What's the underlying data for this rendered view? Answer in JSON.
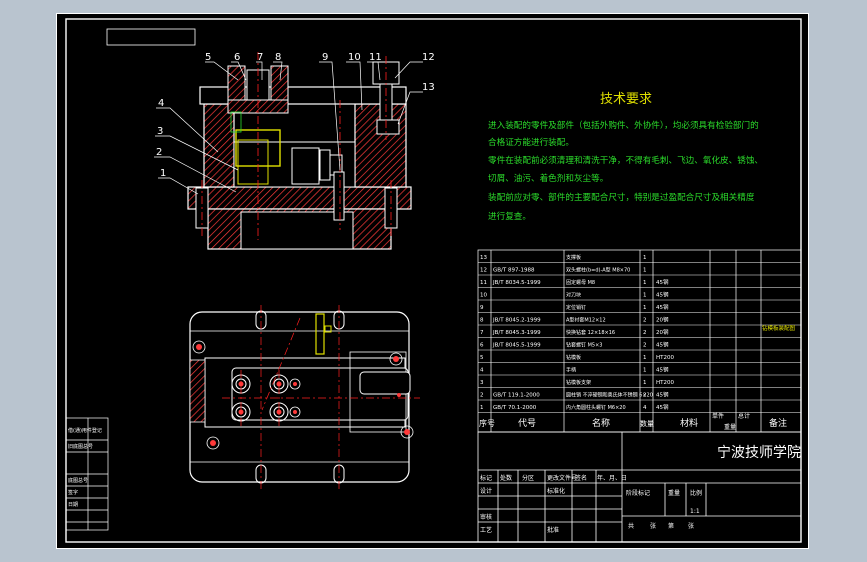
{
  "tech_title": "技术要求",
  "tech_requirements": [
    "进入装配的零件及部件（包括外购件、外协件），均必须具有检验部门的",
    "合格证方能进行装配。",
    "零件在装配前必须清理和清洗干净，不得有毛刺、飞边、氧化皮、锈蚀、",
    "切屑、油污、着色剂和灰尘等。",
    "装配前应对零、部件的主要配合尺寸，特别是过盈配合尺寸及相关精度",
    "进行复查。"
  ],
  "balloons": [
    "1",
    "2",
    "3",
    "4",
    "5",
    "6",
    "7",
    "8",
    "9",
    "10",
    "11",
    "12",
    "13"
  ],
  "bom_rows": [
    {
      "no": "13",
      "code": "",
      "name": "支撑板",
      "qty": "1",
      "material": ""
    },
    {
      "no": "12",
      "code": "GB/T 897-1988",
      "name": "双头螺柱(b=d)-A型 M8×70",
      "qty": "1",
      "material": ""
    },
    {
      "no": "11",
      "code": "JB/T 8034.5-1999",
      "name": "固定螺母 M8",
      "qty": "1",
      "material": "45钢"
    },
    {
      "no": "10",
      "code": "",
      "name": "对刀块",
      "qty": "1",
      "material": "45钢"
    },
    {
      "no": "9",
      "code": "",
      "name": "定位销钉",
      "qty": "1",
      "material": "45钢"
    },
    {
      "no": "8",
      "code": "JB/T 8045.2-1999",
      "name": "A型衬套M12×12",
      "qty": "2",
      "material": "20钢"
    },
    {
      "no": "7",
      "code": "JB/T 8045.3-1999",
      "name": "快换钻套 12×18×16",
      "qty": "2",
      "material": "20钢"
    },
    {
      "no": "6",
      "code": "JB/T 8045.5-1999",
      "name": "钻套螺钉 M5×3",
      "qty": "2",
      "material": "45钢"
    },
    {
      "no": "5",
      "code": "",
      "name": "钻模板",
      "qty": "1",
      "material": "HT200"
    },
    {
      "no": "4",
      "code": "",
      "name": "手柄",
      "qty": "1",
      "material": "45钢"
    },
    {
      "no": "3",
      "code": "",
      "name": "钻模板支架",
      "qty": "1",
      "material": "HT200"
    },
    {
      "no": "2",
      "code": "GB/T 119.1-2000",
      "name": "圆柱销 不淬硬钢和奥氏体不锈钢 6×20",
      "qty": "2",
      "material": "45钢"
    },
    {
      "no": "1",
      "code": "GB/T 70.1-2000",
      "name": "内六角圆柱头螺钉 M6×20",
      "qty": "4",
      "material": "45钢"
    }
  ],
  "bom_side_note": "钻模板装配图",
  "bom_header": {
    "no": "序号",
    "code": "代号",
    "name": "名称",
    "qty": "数量",
    "material": "材料",
    "unit_weight": "单件",
    "total_weight": "总计",
    "weight": "重量",
    "remark": "备注"
  },
  "school": "宁波技师学院",
  "title_block": {
    "mark": "标记",
    "count": "处数",
    "zone": "分区",
    "change_doc": "更改文件号",
    "sign": "签名",
    "date": "年、月、日",
    "design": "设计",
    "standardize": "标准化",
    "stage_mark": "阶段标记",
    "weight": "重量",
    "scale": "比例",
    "scale_value": "1:1",
    "review": "审核",
    "process": "工艺",
    "approve": "批准",
    "sheets_total": "共",
    "sheets_unit": "张",
    "sheet_no": "第"
  },
  "side_panel": [
    "借(通)用件登记",
    "旧底图总号",
    "底图总号",
    "签字",
    "日期"
  ],
  "colors": {
    "background": "#000000",
    "frame": "#ffffff",
    "outline": "#ffffff",
    "hatch": "#ff3a3a",
    "centerline": "#ff2020",
    "tech_text": "#2bdc2b",
    "tech_title": "#e0e000",
    "pin": "#e0e000",
    "bore": "#e0e000"
  }
}
